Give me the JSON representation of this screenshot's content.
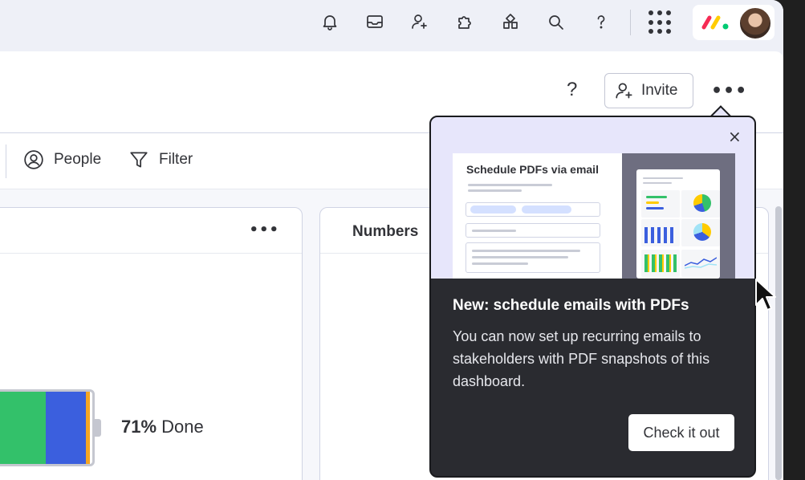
{
  "toolbar": {
    "people_label": "People",
    "filter_label": "Filter"
  },
  "header": {
    "help_label": "?",
    "invite_label": "Invite",
    "more_label": "•••"
  },
  "widgets": [
    {
      "title": "",
      "menu_label": "•••",
      "battery": {
        "done_percent_label": "71%",
        "done_suffix": " Done",
        "segments": [
          {
            "status": "green",
            "color": "#33c16a"
          },
          {
            "status": "blue",
            "color": "#3b5fde"
          },
          {
            "status": "orange",
            "color": "#f5a623"
          }
        ]
      }
    },
    {
      "title": "Numbers"
    }
  ],
  "popover": {
    "close_label": "×",
    "illustration_title": "Schedule PDFs via email",
    "title": "New: schedule emails with PDFs",
    "body": "You can now set up recurring emails to stakeholders with PDF snapshots of this dashboard.",
    "cta_label": "Check it out"
  },
  "topbar_icons": [
    "bell-icon",
    "inbox-icon",
    "invite-member-icon",
    "apps-puzzle-icon",
    "marketplace-icon",
    "search-icon",
    "help-icon",
    "app-grid-icon"
  ],
  "colors": {
    "accent_green": "#33c16a",
    "accent_blue": "#3b5fde",
    "accent_orange": "#f5a623",
    "popover_bg": "#2a2b30",
    "popover_hero_bg": "#e7e6fb"
  }
}
